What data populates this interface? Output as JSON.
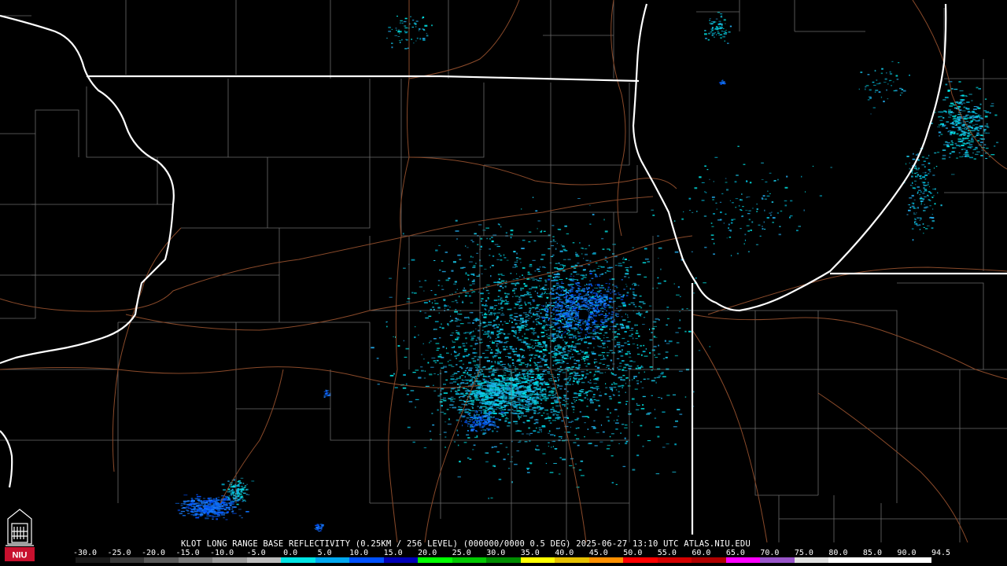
{
  "caption": {
    "station": "KLOT",
    "product": "LONG RANGE BASE REFLECTIVITY",
    "resolution": "(0.25KM / 256 LEVEL)",
    "vcp": "(000000/0000 0.5 DEG)",
    "datetime": "2025-06-27 13:10 UTC",
    "source": "ATLAS.NIU.EDU"
  },
  "logo": {
    "text": "NIU",
    "color": "#c8102e"
  },
  "colorbar": {
    "ticks": [
      "-30.0",
      "-25.0",
      "-20.0",
      "-15.0",
      "-10.0",
      "-5.0",
      "0.0",
      "5.0",
      "10.0",
      "15.0",
      "20.0",
      "25.0",
      "30.0",
      "35.0",
      "40.0",
      "45.0",
      "50.0",
      "55.0",
      "60.0",
      "65.0",
      "70.0",
      "75.0",
      "80.0",
      "85.0",
      "90.0",
      "94.5"
    ],
    "colors": [
      "#1a1a1a",
      "#3a3a3a",
      "#5a5a5a",
      "#7a7a7a",
      "#9a9a9a",
      "#bcbcbc",
      "#00e5e5",
      "#00a8f0",
      "#0050ff",
      "#0000b8",
      "#00ff00",
      "#00c800",
      "#008c00",
      "#ffff00",
      "#e6c000",
      "#ff9000",
      "#ff0000",
      "#d40000",
      "#b00000",
      "#ff00ff",
      "#9955c9",
      "#e0e0e0",
      "#ffffff",
      "#ffffff",
      "#ffffff"
    ]
  },
  "radar": {
    "center_marker_color": "#000000"
  }
}
